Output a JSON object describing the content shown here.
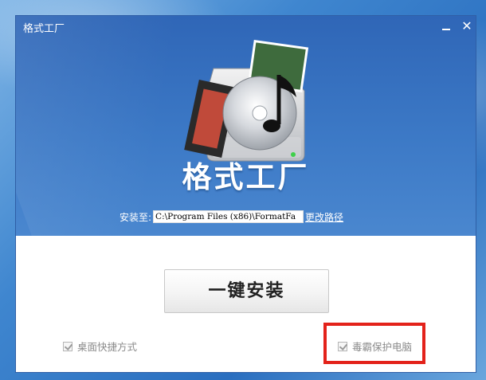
{
  "window": {
    "title": "格式工厂",
    "minimize_icon": "minimize-icon",
    "close_glyph": "✕"
  },
  "hero": {
    "logo_icon": "format-factory-logo",
    "brand_text": "格式工厂"
  },
  "install_path": {
    "label": "安装至:",
    "value": "C:\\Program Files (x86)\\FormatFa",
    "change_link": "更改路径"
  },
  "install_button": {
    "label": "一键安装"
  },
  "options": {
    "shortcut": {
      "label": "桌面快捷方式",
      "checked": true
    },
    "protection": {
      "label": "毒霸保护电脑",
      "checked": true
    }
  },
  "colors": {
    "header_blue": "#3c79c6",
    "highlight_red": "#e3221a"
  }
}
